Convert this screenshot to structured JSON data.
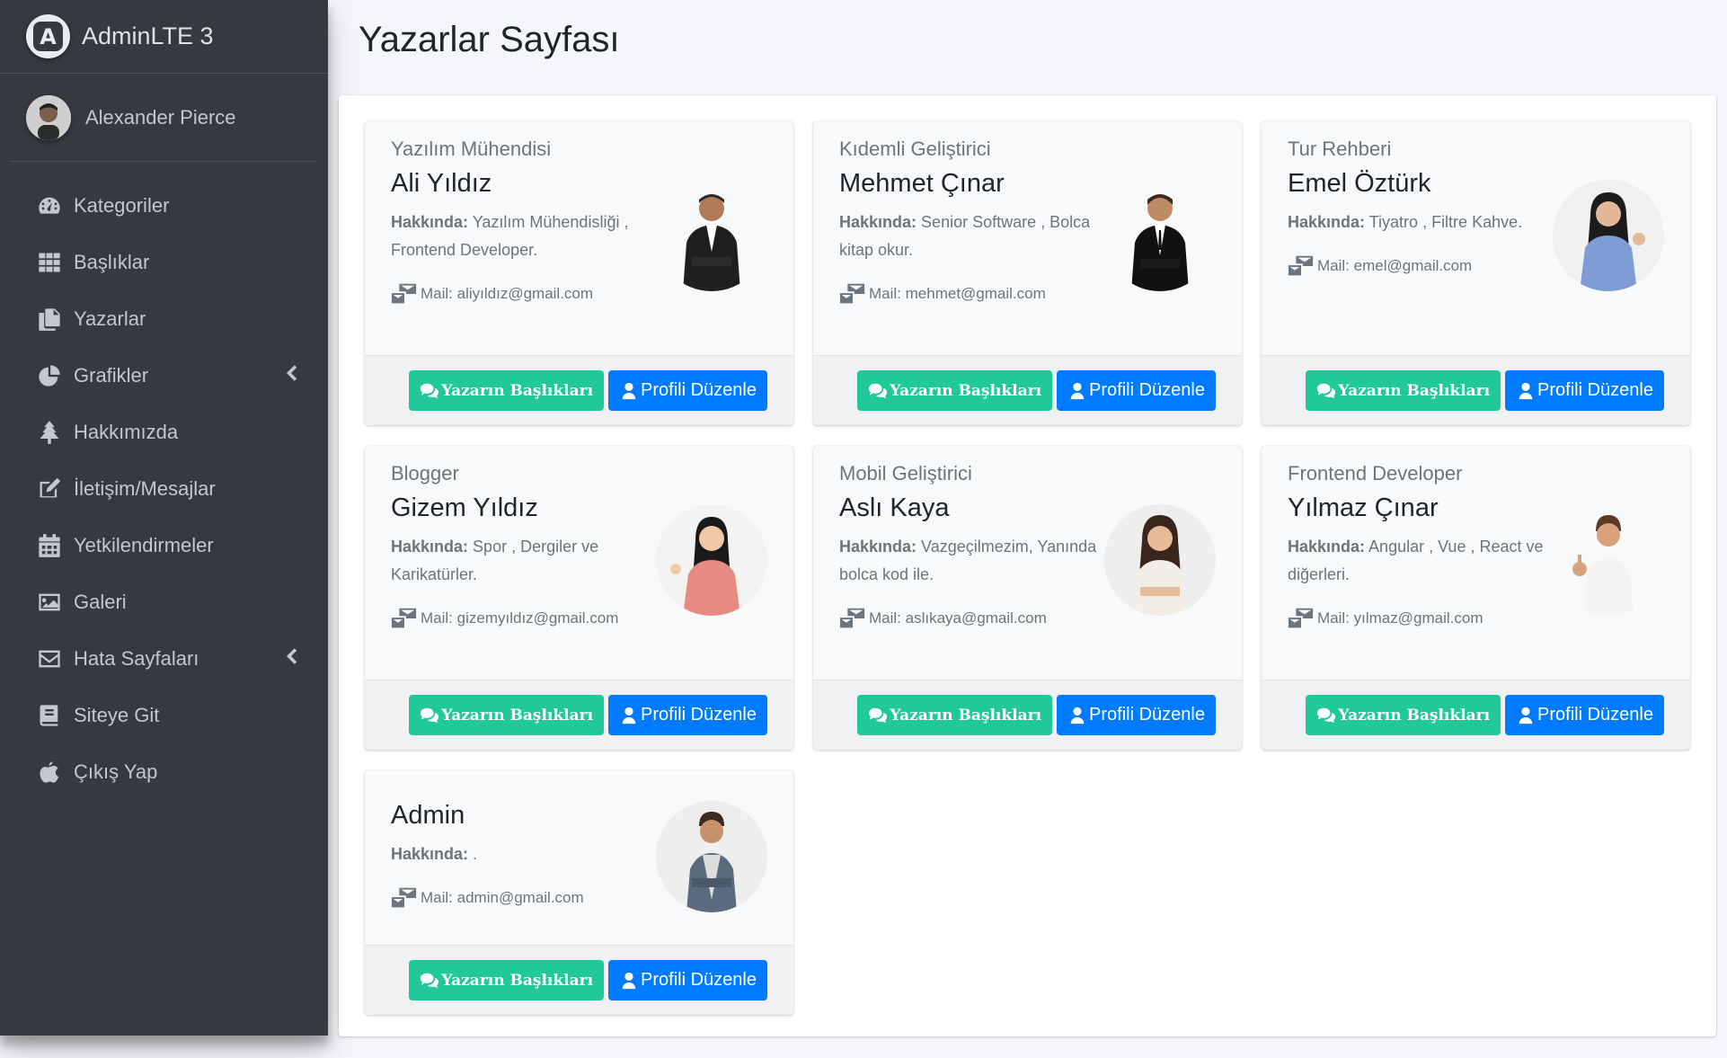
{
  "brand": {
    "name": "AdminLTE 3"
  },
  "user": {
    "name": "Alexander Pierce"
  },
  "sidebar": {
    "items": [
      {
        "label": "Kategoriler",
        "icon": "tachometer-icon"
      },
      {
        "label": "Başlıklar",
        "icon": "grid-icon"
      },
      {
        "label": "Yazarlar",
        "icon": "copy-icon"
      },
      {
        "label": "Grafikler",
        "icon": "pie-chart-icon",
        "has_submenu": true
      },
      {
        "label": "Hakkımızda",
        "icon": "tree-icon"
      },
      {
        "label": "İletişim/Mesajlar",
        "icon": "edit-icon"
      },
      {
        "label": "Yetkilendirmeler",
        "icon": "calendar-icon"
      },
      {
        "label": "Galeri",
        "icon": "image-icon"
      },
      {
        "label": "Hata Sayfaları",
        "icon": "envelope-icon",
        "has_submenu": true
      },
      {
        "label": "Siteye Git",
        "icon": "book-icon"
      },
      {
        "label": "Çıkış Yap",
        "icon": "apple-icon"
      }
    ]
  },
  "page": {
    "title": "Yazarlar Sayfası"
  },
  "buttons": {
    "titles": "Yazarın Başlıkları",
    "edit": "Profili Düzenle"
  },
  "mail_prefix": "Mail:",
  "about_label": "Hakkında:",
  "authors": [
    {
      "role": "Yazılım Mühendisi",
      "name": "Ali Yıldız",
      "about": "Yazılım Mühendisliği , Frontend Developer.",
      "mail": "aliyıldız@gmail.com"
    },
    {
      "role": "Kıdemli Geliştirici",
      "name": "Mehmet Çınar",
      "about": "Senior Software , Bolca kitap okur.",
      "mail": "mehmet@gmail.com"
    },
    {
      "role": "Tur Rehberi",
      "name": "Emel Öztürk",
      "about": "Tiyatro , Filtre Kahve.",
      "mail": "emel@gmail.com"
    },
    {
      "role": "Blogger",
      "name": "Gizem Yıldız",
      "about": "Spor , Dergiler ve Karikatürler.",
      "mail": "gizemyıldız@gmail.com"
    },
    {
      "role": "Mobil Geliştirici",
      "name": "Aslı Kaya",
      "about": "Vazgeçilmezim, Yanında bolca kod ile.",
      "mail": "aslıkaya@gmail.com"
    },
    {
      "role": "Frontend Developer",
      "name": "Yılmaz Çınar",
      "about": "Angular , Vue , React ve diğerleri.",
      "mail": "yılmaz@gmail.com"
    },
    {
      "role": "",
      "name": "Admin",
      "about": ".",
      "mail": "admin@gmail.com"
    }
  ],
  "colors": {
    "sidebar": "#343a40",
    "green": "#20c997",
    "blue": "#007bff"
  }
}
